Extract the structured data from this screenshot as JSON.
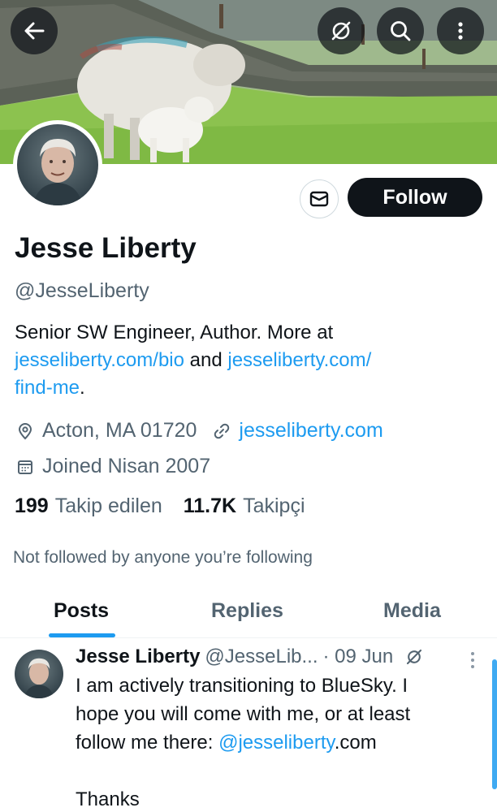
{
  "header": {
    "back_icon": "arrow-left-icon",
    "grok_icon": "grok-icon",
    "search_icon": "search-icon",
    "more_icon": "more-vertical-icon"
  },
  "profile": {
    "name": "Jesse Liberty",
    "handle": "@JesseLiberty",
    "bio_prefix": "Senior SW Engineer, Author. More at",
    "bio_link1": "jesseliberty.com/bio",
    "bio_and": "and",
    "bio_link2": "jesseliberty.com/",
    "bio_link2_cont": "find-me",
    "bio_end": ".",
    "location": "Acton, MA 01720",
    "website": "jesseliberty.com",
    "joined": "Joined Nisan 2007",
    "following_count": "199",
    "following_label": "Takip edilen",
    "followers_count": "11.7K",
    "followers_label": "Takipçi",
    "not_followed": "Not followed by anyone you’re following"
  },
  "actions": {
    "follow_label": "Follow",
    "message_icon": "envelope-icon"
  },
  "tabs": [
    {
      "label": "Posts",
      "active": true
    },
    {
      "label": "Replies",
      "active": false
    },
    {
      "label": "Media",
      "active": false
    }
  ],
  "post": {
    "name": "Jesse Liberty",
    "handle": "@JesseLib...",
    "date": "· 09 Jun",
    "line1": "I am actively transitioning to BlueSky. I",
    "line2": "hope you will come with me, or at least",
    "line3_prefix": "follow me there: ",
    "line3_link": "@jesseliberty",
    "line3_suffix": ".com",
    "line5": "Thanks"
  },
  "colors": {
    "accent": "#1d9bf0",
    "text": "#0f1419",
    "secondary": "#536471"
  }
}
